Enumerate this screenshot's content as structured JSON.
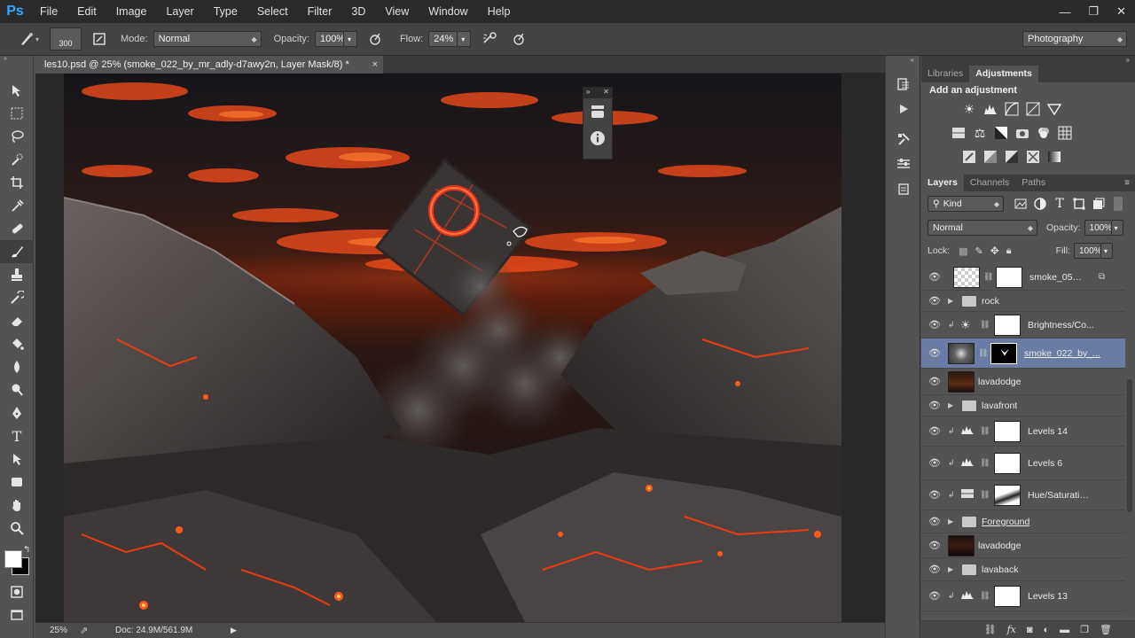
{
  "app": {
    "logo": "Ps"
  },
  "menubar": {
    "items": [
      "File",
      "Edit",
      "Image",
      "Layer",
      "Type",
      "Select",
      "Filter",
      "3D",
      "View",
      "Window",
      "Help"
    ]
  },
  "window_controls": {
    "minimize": "—",
    "restore": "❐",
    "close": "✕"
  },
  "options": {
    "brush_size": "300",
    "mode_label": "Mode:",
    "mode_value": "Normal",
    "opacity_label": "Opacity:",
    "opacity_value": "100%",
    "flow_label": "Flow:",
    "flow_value": "24%",
    "workspace": "Photography"
  },
  "document": {
    "tab_title": "les10.psd @ 25% (smoke_022_by_mr_adly-d7awy2n, Layer Mask/8) *",
    "close": "×"
  },
  "status": {
    "zoom": "25%",
    "doc_size": "Doc: 24.9M/561.9M"
  },
  "panels": {
    "top_tabs": [
      "Libraries",
      "Adjustments"
    ],
    "active_top_tab": "Adjustments",
    "adjustments_title": "Add an adjustment",
    "layer_tabs": [
      "Layers",
      "Channels",
      "Paths"
    ],
    "active_layer_tab": "Layers",
    "filter_kind": "Kind",
    "blend_mode": "Normal",
    "opacity_label": "Opacity:",
    "opacity_value": "100%",
    "lock_label": "Lock:",
    "fill_label": "Fill:",
    "fill_value": "100%"
  },
  "layers": [
    {
      "name": "smoke_051_...",
      "type": "smart-mask"
    },
    {
      "name": "rock",
      "type": "group"
    },
    {
      "name": "Brightness/Co...",
      "type": "adjustment"
    },
    {
      "name": "smoke_022_by_...",
      "type": "selected-mask"
    },
    {
      "name": "lavadodge",
      "type": "image"
    },
    {
      "name": "lavafront",
      "type": "group"
    },
    {
      "name": "Levels 14",
      "type": "adjustment"
    },
    {
      "name": "Levels 6",
      "type": "adjustment"
    },
    {
      "name": "Hue/Saturatio...",
      "type": "adjustment"
    },
    {
      "name": "Foreground",
      "type": "group"
    },
    {
      "name": "lavadodge",
      "type": "image"
    },
    {
      "name": "lavaback",
      "type": "group"
    },
    {
      "name": "Levels 13",
      "type": "adjustment"
    }
  ],
  "colors": {
    "accent_blue": "#31a8ff",
    "selected_layer": "#6b7ca4",
    "lava": "#ff4a12"
  },
  "icons": [
    "brush-icon",
    "move-icon",
    "marquee-icon",
    "lasso-icon",
    "quick-select-icon",
    "crop-icon",
    "eyedropper-icon",
    "healing-icon",
    "brush-tool-icon",
    "stamp-icon",
    "history-brush-icon",
    "eraser-icon",
    "bucket-icon",
    "blur-icon",
    "dodge-icon",
    "pen-icon",
    "type-icon",
    "path-select-icon",
    "shape-icon",
    "hand-icon",
    "zoom-icon",
    "eye-icon",
    "folder-icon",
    "link-icon",
    "fx-icon",
    "trash-icon"
  ]
}
